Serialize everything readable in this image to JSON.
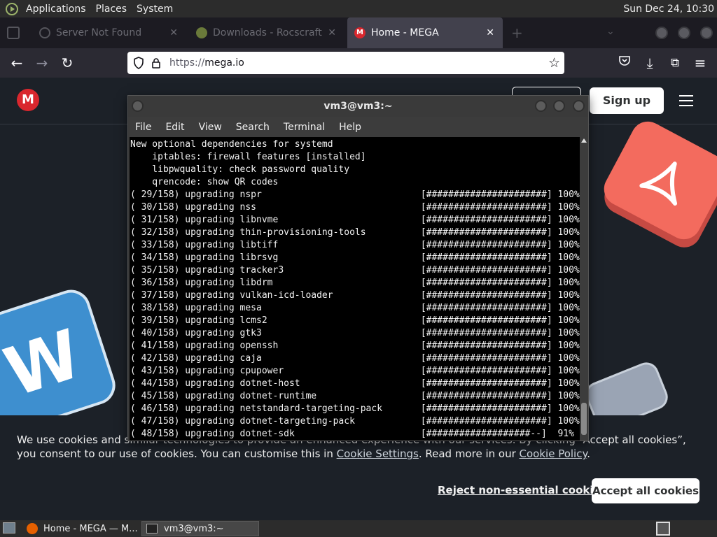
{
  "top_panel": {
    "menus": [
      "Applications",
      "Places",
      "System"
    ],
    "clock": "Sun Dec 24, 10:30"
  },
  "browser": {
    "tabs": [
      {
        "title": "Server Not Found",
        "active": false
      },
      {
        "title": "Downloads - Rocscraft",
        "active": false
      },
      {
        "title": "Home - MEGA",
        "active": true
      }
    ],
    "url_protocol": "https://",
    "url_host": "mega.io"
  },
  "mega": {
    "logo_letter": "M",
    "signup_label": "Sign up",
    "deco_letter": "W"
  },
  "cookie_banner": {
    "text_before_settings": "We use cookies and similar technologies to provide an enhanced experience with our services. By clicking “Accept all cookies”, you consent to our use of cookies. You can customise this in ",
    "settings_link": "Cookie Settings",
    "text_between": ". Read more in our ",
    "policy_link": "Cookie Policy",
    "text_after": ".",
    "reject_label": "Reject non-essential cookies",
    "accept_label": "Accept all cookies"
  },
  "terminal": {
    "title": "vm3@vm3:~",
    "menu": [
      "File",
      "Edit",
      "View",
      "Search",
      "Terminal",
      "Help"
    ],
    "lines": [
      "New optional dependencies for systemd",
      "    iptables: firewall features [installed]",
      "    libpwquality: check password quality",
      "    qrencode: show QR codes",
      "( 29/158) upgrading nspr                             [######################] 100%",
      "( 30/158) upgrading nss                              [######################] 100%",
      "( 31/158) upgrading libnvme                          [######################] 100%",
      "( 32/158) upgrading thin-provisioning-tools          [######################] 100%",
      "( 33/158) upgrading libtiff                          [######################] 100%",
      "( 34/158) upgrading librsvg                          [######################] 100%",
      "( 35/158) upgrading tracker3                         [######################] 100%",
      "( 36/158) upgrading libdrm                           [######################] 100%",
      "( 37/158) upgrading vulkan-icd-loader                [######################] 100%",
      "( 38/158) upgrading mesa                             [######################] 100%",
      "( 39/158) upgrading lcms2                            [######################] 100%",
      "( 40/158) upgrading gtk3                             [######################] 100%",
      "( 41/158) upgrading openssh                          [######################] 100%",
      "( 42/158) upgrading caja                             [######################] 100%",
      "( 43/158) upgrading cpupower                         [######################] 100%",
      "( 44/158) upgrading dotnet-host                      [######################] 100%",
      "( 45/158) upgrading dotnet-runtime                   [######################] 100%",
      "( 46/158) upgrading netstandard-targeting-pack       [######################] 100%",
      "( 47/158) upgrading dotnet-targeting-pack            [######################] 100%",
      "( 48/158) upgrading dotnet-sdk                       [###################--]  91%"
    ]
  },
  "taskbar": {
    "tasks": [
      "Home - MEGA — M...",
      "vm3@vm3:~"
    ]
  }
}
